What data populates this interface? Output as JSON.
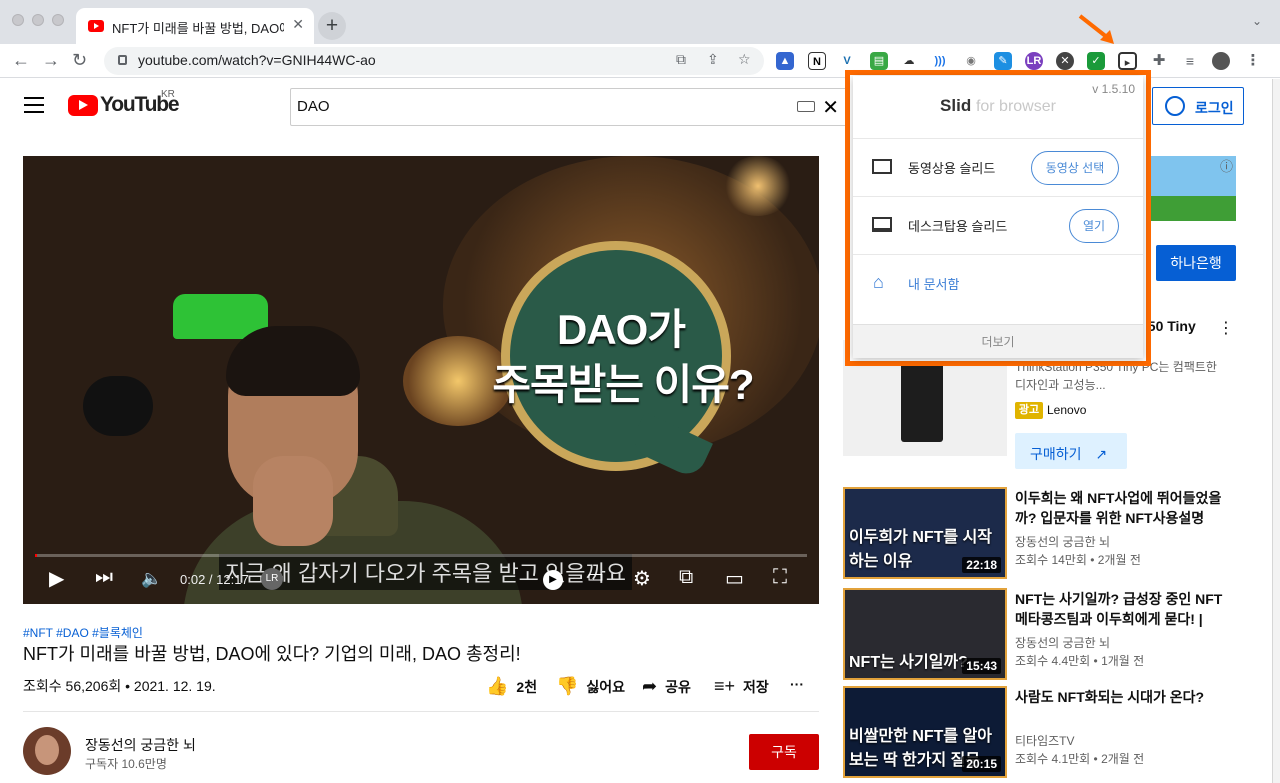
{
  "browser": {
    "tab_title": "NFT가 미래를 바꿀 방법, DAO에 있",
    "tab_close": "✕",
    "new_tab": "+",
    "url": "youtube.com/watch?v=GNIH44WC-ao",
    "extensions": [
      "slid",
      "notion",
      "vimeo",
      "calculator",
      "cloud",
      "audio",
      "camera",
      "feather",
      "lr",
      "x",
      "check",
      "slid-popup-trigger",
      "puzzle",
      "reading-list",
      "profile"
    ]
  },
  "youtube": {
    "logo_text": "YouTube",
    "region": "KR",
    "search_query": "DAO",
    "login_label": "로그인"
  },
  "player": {
    "overlay_line1": "DAO가",
    "overlay_line2": "주목받는 이유?",
    "caption": "지금 왜 갑자기 다오가 주목을 받고 있을까요",
    "timecode": "0:02 / 12:17",
    "progress_fraction": 0.003
  },
  "video": {
    "hashtags": "#NFT #DAO #블록체인",
    "title": "NFT가 미래를 바꿀 방법, DAO에 있다? 기업의 미래, DAO 총정리!",
    "stats": "조회수 56,206회 • 2021. 12. 19.",
    "likes": "2천",
    "dislike": "싫어요",
    "share": "공유",
    "save": "저장",
    "more": "···"
  },
  "channel": {
    "name": "장동선의 궁금한 뇌",
    "subscribers": "구독자 10.6만명",
    "subscribe": "구독"
  },
  "ad": {
    "hana_button": "하나은행",
    "title_tail": "350 Tiny",
    "desc": "ThinkStation P350 Tiny PC는 컴팩트한 디자인과 고성능...",
    "badge": "광고",
    "brand": "Lenovo",
    "buy": "구매하기"
  },
  "recommendations": [
    {
      "title": "이두희는 왜 NFT사업에 뛰어들었을까? 입문자를 위한 NFT사용설명서...",
      "channel": "장동선의 궁금한 뇌",
      "meta": "조회수 14만회 • 2개월 전",
      "duration": "22:18",
      "thumb_text": "이두희가 NFT를 시작하는 이유",
      "thumb_bg": "#1c2a4a"
    },
    {
      "title": "NFT는 사기일까? 급성장 중인 NFT 메타콩즈팀과 이두희에게 묻다! | 메...",
      "channel": "장동선의 궁금한 뇌",
      "meta": "조회수 4.4만회 • 1개월 전",
      "duration": "15:43",
      "thumb_text": "NFT는 사기일까?",
      "thumb_bg": "#2a2a30"
    },
    {
      "title": "사람도 NFT화되는 시대가 온다?",
      "channel": "티타임즈TV",
      "meta": "조회수 4.1만회 • 2개월 전",
      "duration": "20:15",
      "thumb_text": "비쌀만한 NFT를 알아보는 딱 한가지 질문",
      "thumb_bg": "#0d1b36"
    }
  ],
  "slid_popup": {
    "version": "v 1.5.10",
    "logo": "Slid",
    "logo_suffix": "for browser",
    "video_slide_label": "동영상용 슬리드",
    "video_select_button": "동영상 선택",
    "desktop_slide_label": "데스크탑용 슬리드",
    "open_button": "열기",
    "my_docs_label": "내 문서함",
    "more_label": "더보기"
  },
  "colors": {
    "youtube_red": "#ff0000",
    "link_blue": "#065fd4",
    "highlight_orange": "#ff6a00",
    "subscribe_red": "#cc0000"
  }
}
